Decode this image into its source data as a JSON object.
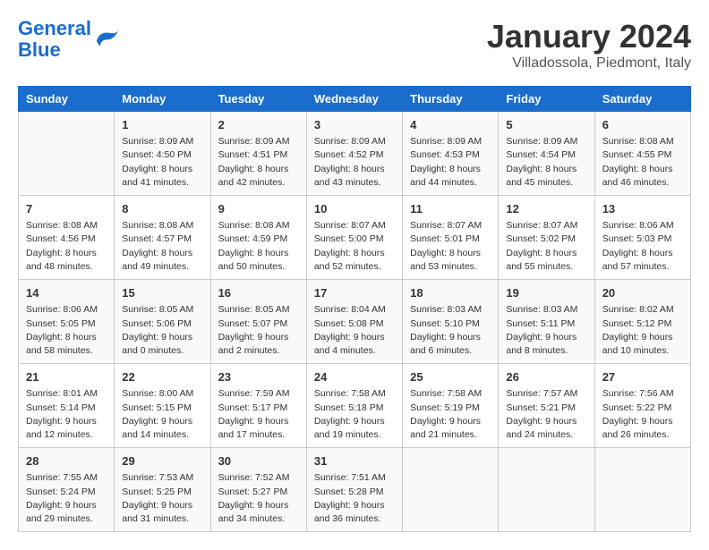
{
  "header": {
    "logo_line1": "General",
    "logo_line2": "Blue",
    "title": "January 2024",
    "subtitle": "Villadossola, Piedmont, Italy"
  },
  "days_of_week": [
    "Sunday",
    "Monday",
    "Tuesday",
    "Wednesday",
    "Thursday",
    "Friday",
    "Saturday"
  ],
  "weeks": [
    [
      {
        "day": "",
        "info": ""
      },
      {
        "day": "1",
        "info": "Sunrise: 8:09 AM\nSunset: 4:50 PM\nDaylight: 8 hours\nand 41 minutes."
      },
      {
        "day": "2",
        "info": "Sunrise: 8:09 AM\nSunset: 4:51 PM\nDaylight: 8 hours\nand 42 minutes."
      },
      {
        "day": "3",
        "info": "Sunrise: 8:09 AM\nSunset: 4:52 PM\nDaylight: 8 hours\nand 43 minutes."
      },
      {
        "day": "4",
        "info": "Sunrise: 8:09 AM\nSunset: 4:53 PM\nDaylight: 8 hours\nand 44 minutes."
      },
      {
        "day": "5",
        "info": "Sunrise: 8:09 AM\nSunset: 4:54 PM\nDaylight: 8 hours\nand 45 minutes."
      },
      {
        "day": "6",
        "info": "Sunrise: 8:08 AM\nSunset: 4:55 PM\nDaylight: 8 hours\nand 46 minutes."
      }
    ],
    [
      {
        "day": "7",
        "info": "Sunrise: 8:08 AM\nSunset: 4:56 PM\nDaylight: 8 hours\nand 48 minutes."
      },
      {
        "day": "8",
        "info": "Sunrise: 8:08 AM\nSunset: 4:57 PM\nDaylight: 8 hours\nand 49 minutes."
      },
      {
        "day": "9",
        "info": "Sunrise: 8:08 AM\nSunset: 4:59 PM\nDaylight: 8 hours\nand 50 minutes."
      },
      {
        "day": "10",
        "info": "Sunrise: 8:07 AM\nSunset: 5:00 PM\nDaylight: 8 hours\nand 52 minutes."
      },
      {
        "day": "11",
        "info": "Sunrise: 8:07 AM\nSunset: 5:01 PM\nDaylight: 8 hours\nand 53 minutes."
      },
      {
        "day": "12",
        "info": "Sunrise: 8:07 AM\nSunset: 5:02 PM\nDaylight: 8 hours\nand 55 minutes."
      },
      {
        "day": "13",
        "info": "Sunrise: 8:06 AM\nSunset: 5:03 PM\nDaylight: 8 hours\nand 57 minutes."
      }
    ],
    [
      {
        "day": "14",
        "info": "Sunrise: 8:06 AM\nSunset: 5:05 PM\nDaylight: 8 hours\nand 58 minutes."
      },
      {
        "day": "15",
        "info": "Sunrise: 8:05 AM\nSunset: 5:06 PM\nDaylight: 9 hours\nand 0 minutes."
      },
      {
        "day": "16",
        "info": "Sunrise: 8:05 AM\nSunset: 5:07 PM\nDaylight: 9 hours\nand 2 minutes."
      },
      {
        "day": "17",
        "info": "Sunrise: 8:04 AM\nSunset: 5:08 PM\nDaylight: 9 hours\nand 4 minutes."
      },
      {
        "day": "18",
        "info": "Sunrise: 8:03 AM\nSunset: 5:10 PM\nDaylight: 9 hours\nand 6 minutes."
      },
      {
        "day": "19",
        "info": "Sunrise: 8:03 AM\nSunset: 5:11 PM\nDaylight: 9 hours\nand 8 minutes."
      },
      {
        "day": "20",
        "info": "Sunrise: 8:02 AM\nSunset: 5:12 PM\nDaylight: 9 hours\nand 10 minutes."
      }
    ],
    [
      {
        "day": "21",
        "info": "Sunrise: 8:01 AM\nSunset: 5:14 PM\nDaylight: 9 hours\nand 12 minutes."
      },
      {
        "day": "22",
        "info": "Sunrise: 8:00 AM\nSunset: 5:15 PM\nDaylight: 9 hours\nand 14 minutes."
      },
      {
        "day": "23",
        "info": "Sunrise: 7:59 AM\nSunset: 5:17 PM\nDaylight: 9 hours\nand 17 minutes."
      },
      {
        "day": "24",
        "info": "Sunrise: 7:58 AM\nSunset: 5:18 PM\nDaylight: 9 hours\nand 19 minutes."
      },
      {
        "day": "25",
        "info": "Sunrise: 7:58 AM\nSunset: 5:19 PM\nDaylight: 9 hours\nand 21 minutes."
      },
      {
        "day": "26",
        "info": "Sunrise: 7:57 AM\nSunset: 5:21 PM\nDaylight: 9 hours\nand 24 minutes."
      },
      {
        "day": "27",
        "info": "Sunrise: 7:56 AM\nSunset: 5:22 PM\nDaylight: 9 hours\nand 26 minutes."
      }
    ],
    [
      {
        "day": "28",
        "info": "Sunrise: 7:55 AM\nSunset: 5:24 PM\nDaylight: 9 hours\nand 29 minutes."
      },
      {
        "day": "29",
        "info": "Sunrise: 7:53 AM\nSunset: 5:25 PM\nDaylight: 9 hours\nand 31 minutes."
      },
      {
        "day": "30",
        "info": "Sunrise: 7:52 AM\nSunset: 5:27 PM\nDaylight: 9 hours\nand 34 minutes."
      },
      {
        "day": "31",
        "info": "Sunrise: 7:51 AM\nSunset: 5:28 PM\nDaylight: 9 hours\nand 36 minutes."
      },
      {
        "day": "",
        "info": ""
      },
      {
        "day": "",
        "info": ""
      },
      {
        "day": "",
        "info": ""
      }
    ]
  ]
}
